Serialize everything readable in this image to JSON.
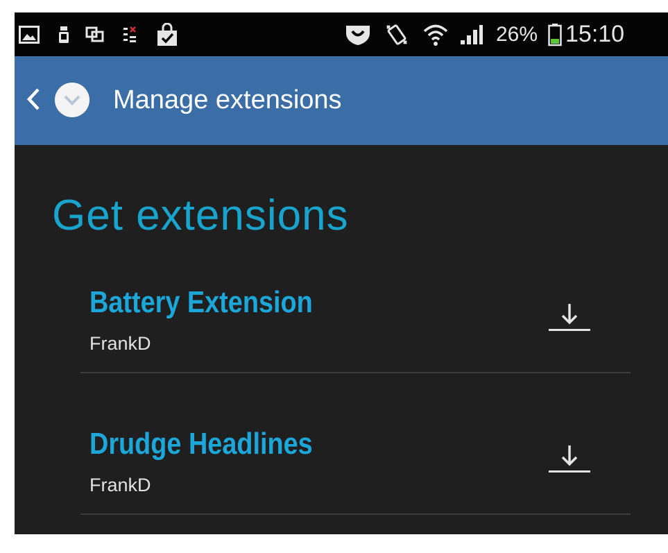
{
  "status_bar": {
    "battery_percent": "26%",
    "time": "15:10",
    "notification_icons": [
      "image-icon",
      "phone-icon",
      "screen-mirror-icon",
      "data-blocked-icon",
      "shopping-bag-icon"
    ],
    "system_icons": [
      "shield-icon",
      "vibrate-icon",
      "wifi-icon",
      "signal-icon",
      "battery-icon"
    ]
  },
  "toolbar": {
    "title": "Manage extensions",
    "background": "#3b6da7"
  },
  "section": {
    "title": "Get extensions",
    "color": "#18a4cc"
  },
  "extensions": [
    {
      "name": "Battery Extension",
      "author": "FrankD",
      "action_icon": "download-icon"
    },
    {
      "name": "Drudge Headlines",
      "author": "FrankD",
      "action_icon": "download-icon"
    }
  ],
  "colors": {
    "background": "#1f1f1f",
    "accent": "#1ca6d9",
    "text": "#e2e2e2"
  }
}
